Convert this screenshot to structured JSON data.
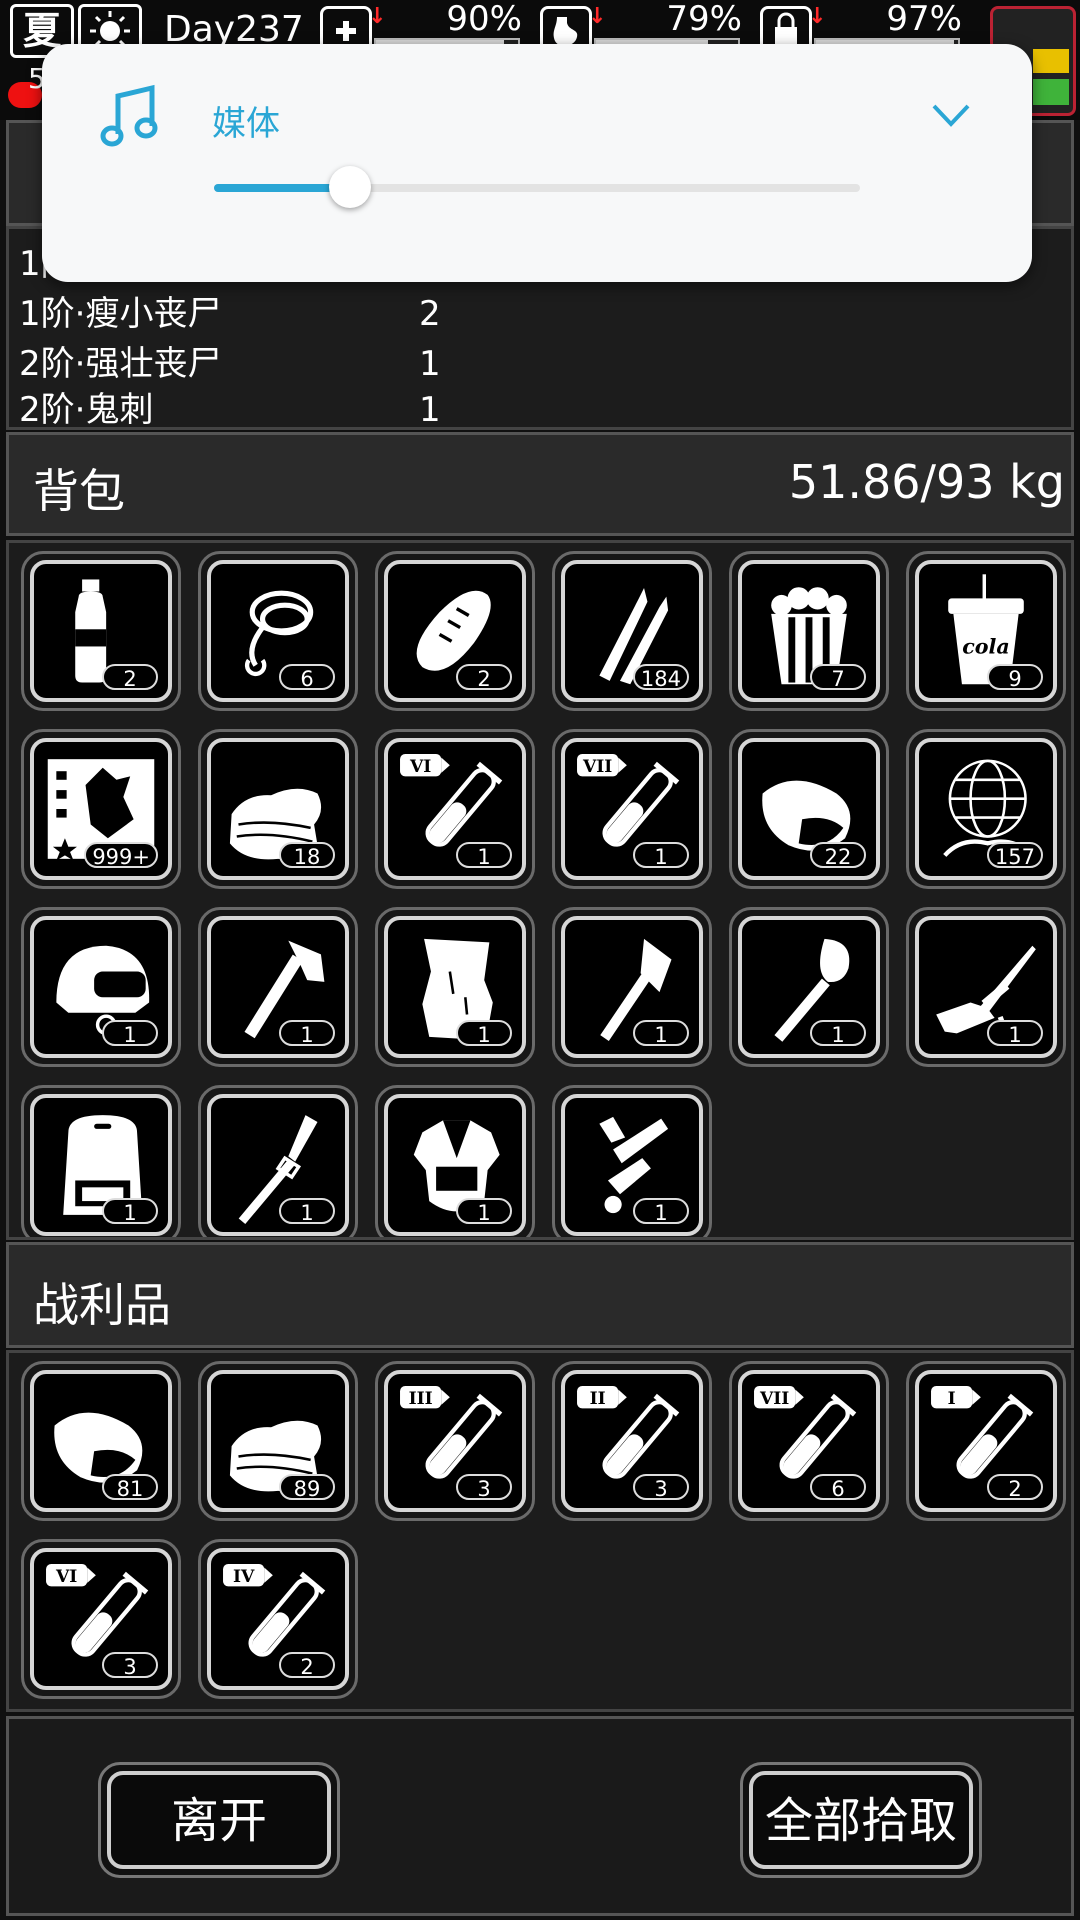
{
  "status": {
    "season": "夏",
    "day": "Day237",
    "health_pct": "90%",
    "hunger_pct": "79%",
    "mood_pct": "97%",
    "hp_number": "5",
    "health_fill": 0.9,
    "hunger_fill": 0.79,
    "mood_fill": 0.97
  },
  "kills": [
    {
      "name": "1阶",
      "count": ""
    },
    {
      "name": "1阶·瘦小丧尸",
      "count": "2"
    },
    {
      "name": "2阶·强壮丧尸",
      "count": "1"
    },
    {
      "name": "2阶·鬼刺",
      "count": "1"
    }
  ],
  "backpack": {
    "title": "背包",
    "weight": "51.86/93 kg",
    "items": [
      {
        "icon": "water-bottle-icon",
        "count": "2"
      },
      {
        "icon": "rope-icon",
        "count": "6"
      },
      {
        "icon": "bread-icon",
        "count": "2"
      },
      {
        "icon": "bullets-icon",
        "count": "184"
      },
      {
        "icon": "popcorn-icon",
        "count": "7"
      },
      {
        "icon": "cola-cup-icon",
        "count": "9"
      },
      {
        "icon": "zombie-card-icon",
        "count": "999+"
      },
      {
        "icon": "cloth-icon",
        "count": "18"
      },
      {
        "icon": "serum-vi-icon",
        "count": "1"
      },
      {
        "icon": "serum-vii-icon",
        "count": "1"
      },
      {
        "icon": "meat-icon",
        "count": "22"
      },
      {
        "icon": "globe-net-icon",
        "count": "157"
      },
      {
        "icon": "helmet-icon",
        "count": "1"
      },
      {
        "icon": "hatchet-icon",
        "count": "1"
      },
      {
        "icon": "wood-board-icon",
        "count": "1"
      },
      {
        "icon": "axe-icon",
        "count": "1"
      },
      {
        "icon": "shovel-icon",
        "count": "1"
      },
      {
        "icon": "sniper-rifle-icon",
        "count": "1"
      },
      {
        "icon": "backpack-icon",
        "count": "1"
      },
      {
        "icon": "spear-icon",
        "count": "1"
      },
      {
        "icon": "armor-icon",
        "count": "1"
      },
      {
        "icon": "trumpet-icon",
        "count": "1"
      }
    ]
  },
  "loot": {
    "title": "战利品",
    "items": [
      {
        "icon": "meat-icon",
        "count": "81"
      },
      {
        "icon": "cloth-icon",
        "count": "89"
      },
      {
        "icon": "serum-iii-icon",
        "count": "3"
      },
      {
        "icon": "serum-ii-icon",
        "count": "3"
      },
      {
        "icon": "serum-vii-icon",
        "count": "6"
      },
      {
        "icon": "serum-i-icon",
        "count": "2"
      },
      {
        "icon": "serum-vi-icon",
        "count": "3"
      },
      {
        "icon": "serum-iv-icon",
        "count": "2"
      }
    ]
  },
  "buttons": {
    "leave": "离开",
    "pickup_all": "全部拾取"
  },
  "media_popup": {
    "label": "媒体",
    "volume": 0.21,
    "accent": "#2aa6d5"
  },
  "serum_labels": {
    "serum-i-icon": "I",
    "serum-ii-icon": "II",
    "serum-iii-icon": "III",
    "serum-iv-icon": "IV",
    "serum-vi-icon": "VI",
    "serum-vii-icon": "VII"
  },
  "cola_text": "cola"
}
